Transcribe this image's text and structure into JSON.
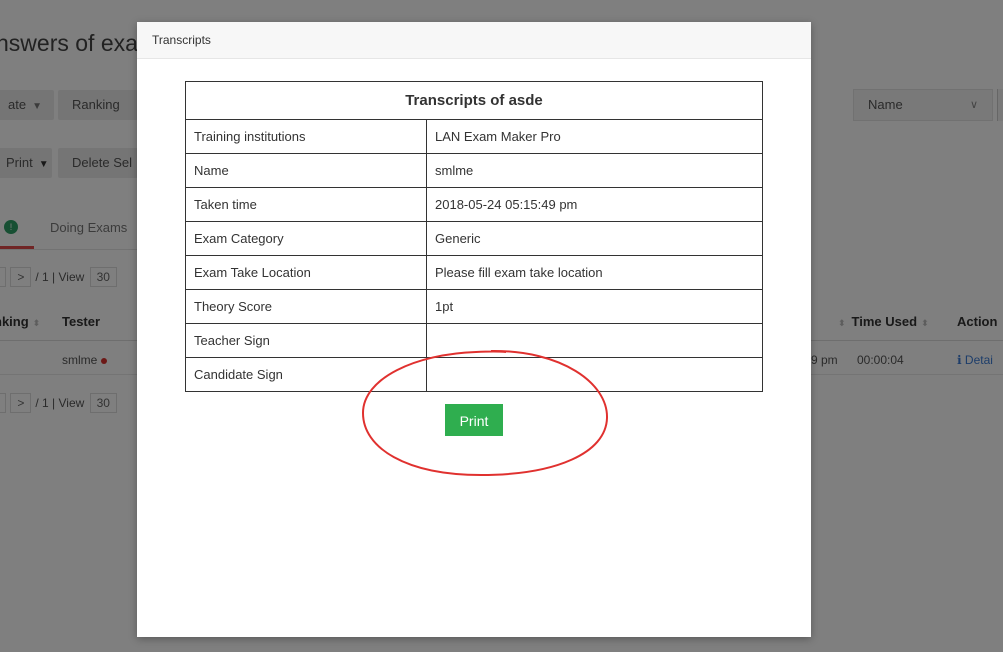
{
  "background": {
    "page_title": "nswers of exar",
    "buttons": {
      "date_label": "ate",
      "ranking_label": "Ranking",
      "print_label": "Print",
      "delete_label": "Delete Sel"
    },
    "select": {
      "value": "Name"
    },
    "tab": {
      "badge": "!",
      "label": "Doing Exams"
    },
    "pager": {
      "info": "/ 1 | View",
      "page_size": "30",
      "next": ">"
    },
    "table": {
      "headers": [
        "nking",
        "Tester",
        "Time Used",
        "Action"
      ],
      "row": {
        "tester": "smlme",
        "time_partial": "9 pm",
        "time_used": "00:00:04",
        "action": "Detai"
      }
    }
  },
  "modal": {
    "title": "Transcripts",
    "table_title": "Transcripts of asde",
    "rows": [
      {
        "label": "Training institutions",
        "value": "LAN Exam Maker Pro"
      },
      {
        "label": "Name",
        "value": "smlme"
      },
      {
        "label": "Taken time",
        "value": "2018-05-24 05:15:49 pm"
      },
      {
        "label": "Exam Category",
        "value": "Generic"
      },
      {
        "label": "Exam Take Location",
        "value": "Please fill exam take location"
      },
      {
        "label": "Theory Score",
        "value": "1pt"
      },
      {
        "label": "Teacher Sign",
        "value": ""
      },
      {
        "label": "Candidate Sign",
        "value": ""
      }
    ],
    "print_label": "Print"
  },
  "colors": {
    "print_button": "#2fae4f",
    "annotation_circle": "#e0312f",
    "tab_underline": "#e04b4b"
  }
}
